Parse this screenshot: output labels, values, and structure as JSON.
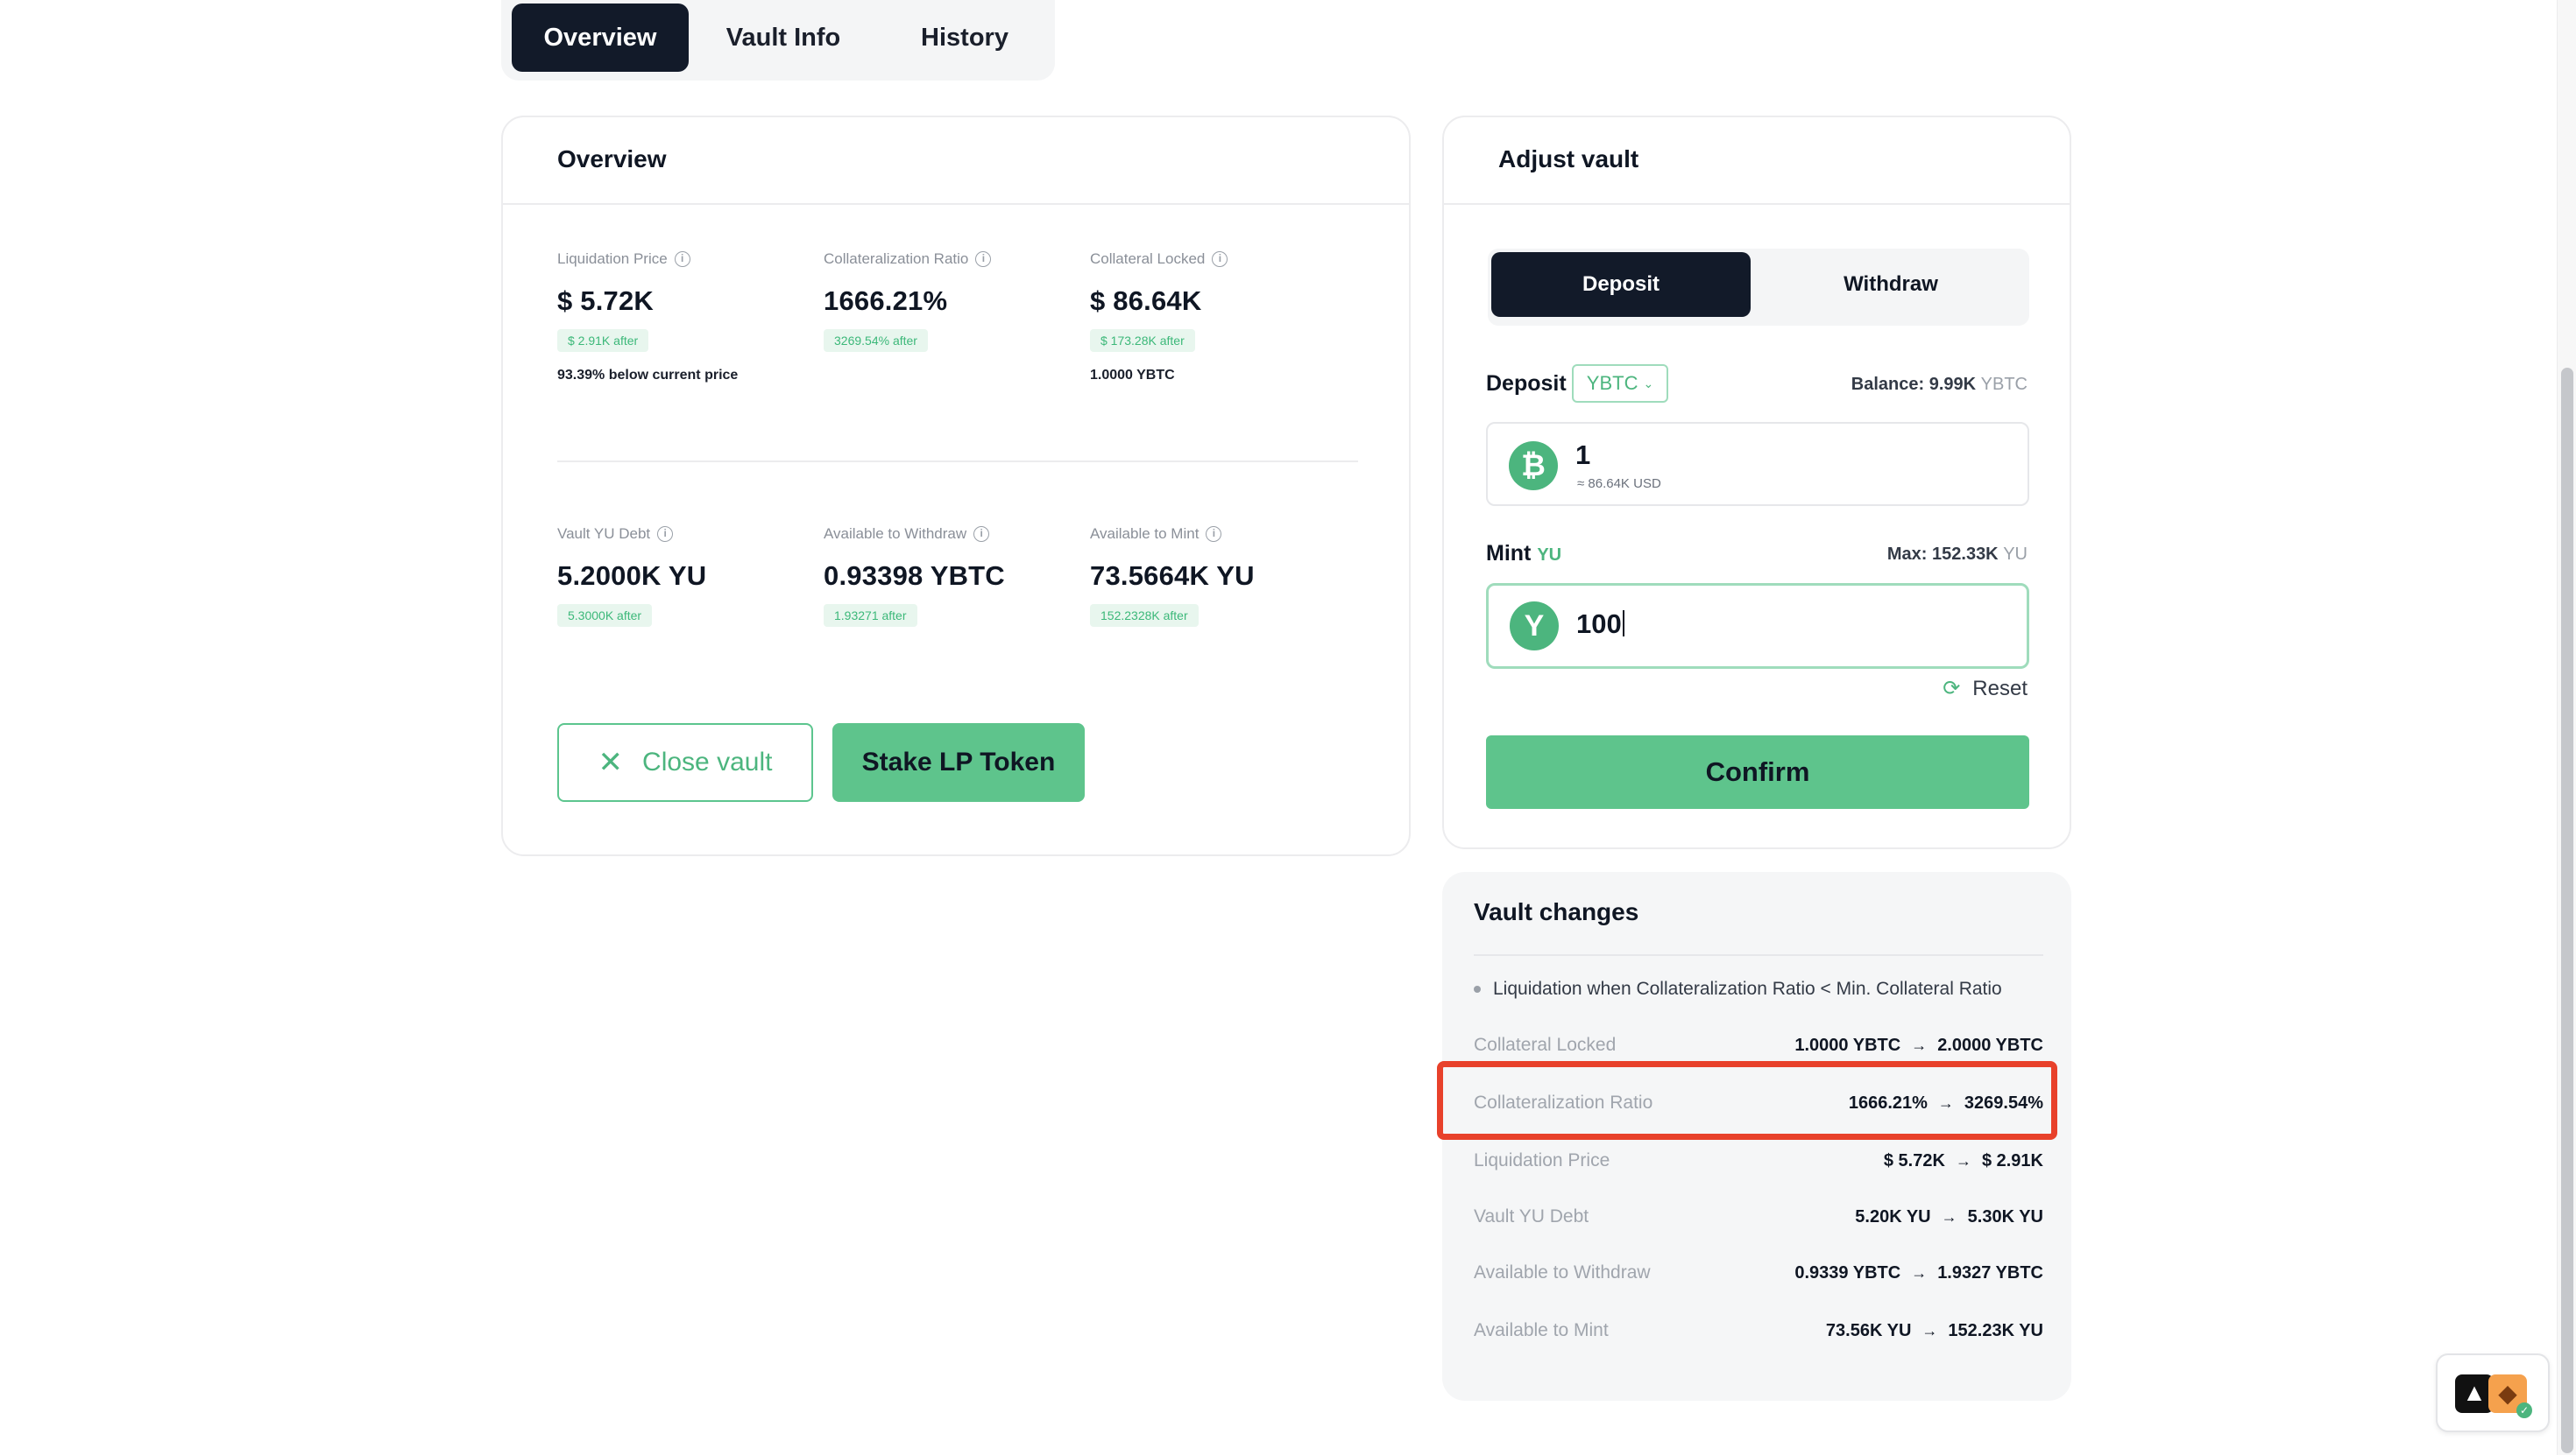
{
  "tabs": {
    "overview": "Overview",
    "vault_info": "Vault Info",
    "history": "History"
  },
  "overview": {
    "title": "Overview",
    "stats": [
      {
        "label": "Liquidation Price",
        "value": "$ 5.72K",
        "after": "$ 2.91K after",
        "note": "93.39% below current price"
      },
      {
        "label": "Collateralization Ratio",
        "value": "1666.21%",
        "after": "3269.54% after",
        "note": ""
      },
      {
        "label": "Collateral Locked",
        "value": "$ 86.64K",
        "after": "$ 173.28K after",
        "note": "1.0000 YBTC"
      },
      {
        "label": "Vault YU Debt",
        "value": "5.2000K YU",
        "after": "5.3000K after",
        "note": ""
      },
      {
        "label": "Available to Withdraw",
        "value": "0.93398 YBTC",
        "after": "1.93271 after",
        "note": ""
      },
      {
        "label": "Available to Mint",
        "value": "73.5664K YU",
        "after": "152.2328K after",
        "note": ""
      }
    ],
    "close_vault": "Close vault",
    "stake_lp": "Stake LP Token"
  },
  "adjust": {
    "title": "Adjust vault",
    "deposit_tab": "Deposit",
    "withdraw_tab": "Withdraw",
    "deposit_label": "Deposit",
    "deposit_token": "YBTC",
    "balance_label": "Balance: 9.99K",
    "balance_unit": "YBTC",
    "deposit_value": "1",
    "deposit_usd": "≈ 86.64K USD",
    "mint_label": "Mint",
    "mint_unit": "YU",
    "max_label": "Max: 152.33K",
    "max_unit": "YU",
    "mint_value": "100",
    "reset": "Reset",
    "confirm": "Confirm"
  },
  "changes": {
    "title": "Vault changes",
    "note": "Liquidation when Collateralization Ratio < Min. Collateral Ratio",
    "rows": [
      {
        "label": "Collateral Locked",
        "from": "1.0000 YBTC",
        "to": "2.0000 YBTC"
      },
      {
        "label": "Collateralization Ratio",
        "from": "1666.21%",
        "to": "3269.54%"
      },
      {
        "label": "Liquidation Price",
        "from": "$ 5.72K",
        "to": "$ 2.91K"
      },
      {
        "label": "Vault YU Debt",
        "from": "5.20K YU",
        "to": "5.30K YU"
      },
      {
        "label": "Available to Withdraw",
        "from": "0.9339 YBTC",
        "to": "1.9327 YBTC"
      },
      {
        "label": "Available to Mint",
        "from": "73.56K YU",
        "to": "152.23K YU"
      }
    ]
  },
  "icons": {
    "info": "info-icon",
    "close": "close-icon",
    "btc": "bitcoin-icon",
    "yu": "yu-token-icon",
    "reset": "refresh-icon",
    "arrow": "arrow-right-icon"
  },
  "colors": {
    "accent": "#5ec48c",
    "dark": "#121a29",
    "highlight": "#e8412b"
  }
}
